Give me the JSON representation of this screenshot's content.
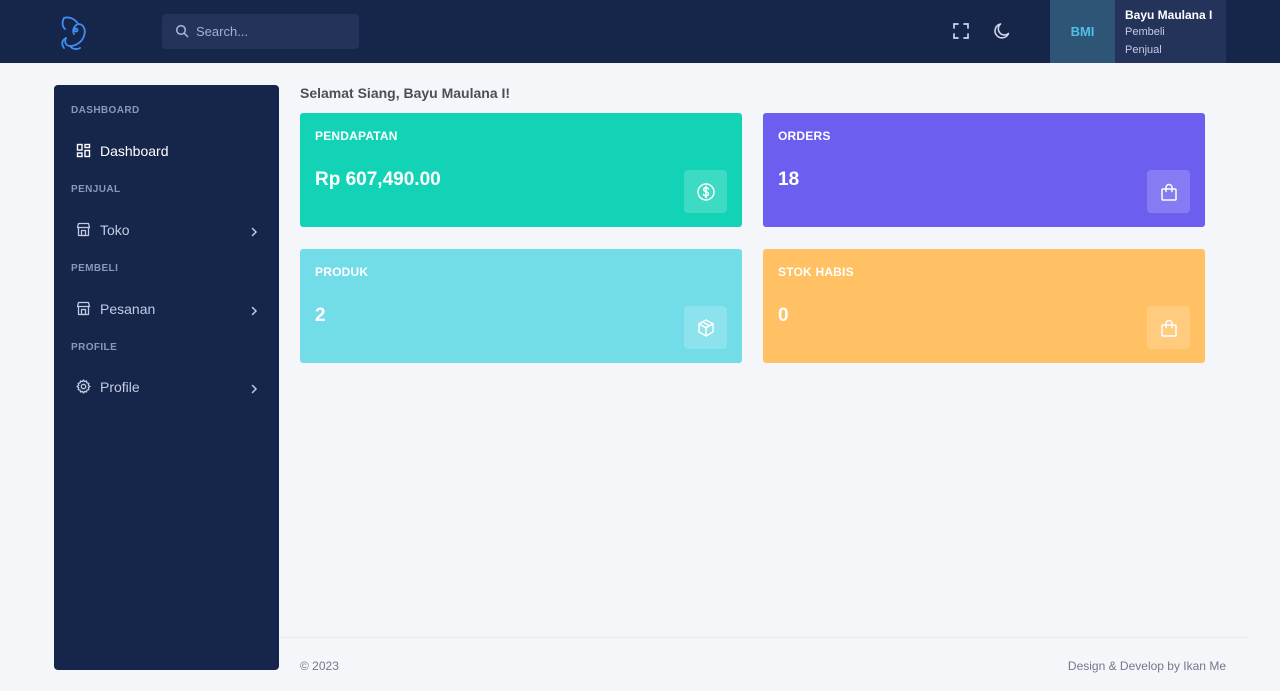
{
  "topbar": {
    "logo_icon": "fish-logo-icon",
    "search": {
      "placeholder": "Search...",
      "value": ""
    },
    "fullscreen_icon": "fullscreen-icon",
    "theme_icon": "moon-icon",
    "user": {
      "initials": "BMI",
      "name": "Bayu Maulana I",
      "roles": [
        "Pembeli",
        "Penjual"
      ]
    }
  },
  "sidebar": {
    "sections": [
      {
        "title": "DASHBOARD",
        "items": [
          {
            "label": "Dashboard",
            "icon": "dashboard-grid-icon",
            "active": true
          }
        ]
      },
      {
        "title": "PENJUAL",
        "items": [
          {
            "label": "Toko",
            "icon": "store-icon"
          }
        ]
      },
      {
        "title": "PEMBELI",
        "items": [
          {
            "label": "Pesanan",
            "icon": "store-icon"
          }
        ]
      },
      {
        "title": "PROFILE",
        "items": [
          {
            "label": "Profile",
            "icon": "gear-icon"
          }
        ]
      }
    ]
  },
  "main": {
    "greeting": "Selamat Siang, Bayu Maulana I!",
    "cards": [
      {
        "label": "PENDAPATAN",
        "value": "Rp 607,490.00",
        "icon": "dollar-circle-icon",
        "color": "#13d3b7"
      },
      {
        "label": "ORDERS",
        "value": "18",
        "icon": "shopping-bag-icon",
        "color": "#6c5ff0"
      },
      {
        "label": "PRODUK",
        "value": "2",
        "icon": "package-icon",
        "color": "#73dce9"
      },
      {
        "label": "STOK HABIS",
        "value": "0",
        "icon": "shopping-bag-icon",
        "color": "#ffc163"
      }
    ]
  },
  "footer": {
    "copyright": "© 2023",
    "credit": "Design & Develop by Ikan Me"
  },
  "colors": {
    "topbar_bg": "#16254a",
    "sidebar_bg": "#16254a",
    "page_bg": "#f5f6f9"
  }
}
